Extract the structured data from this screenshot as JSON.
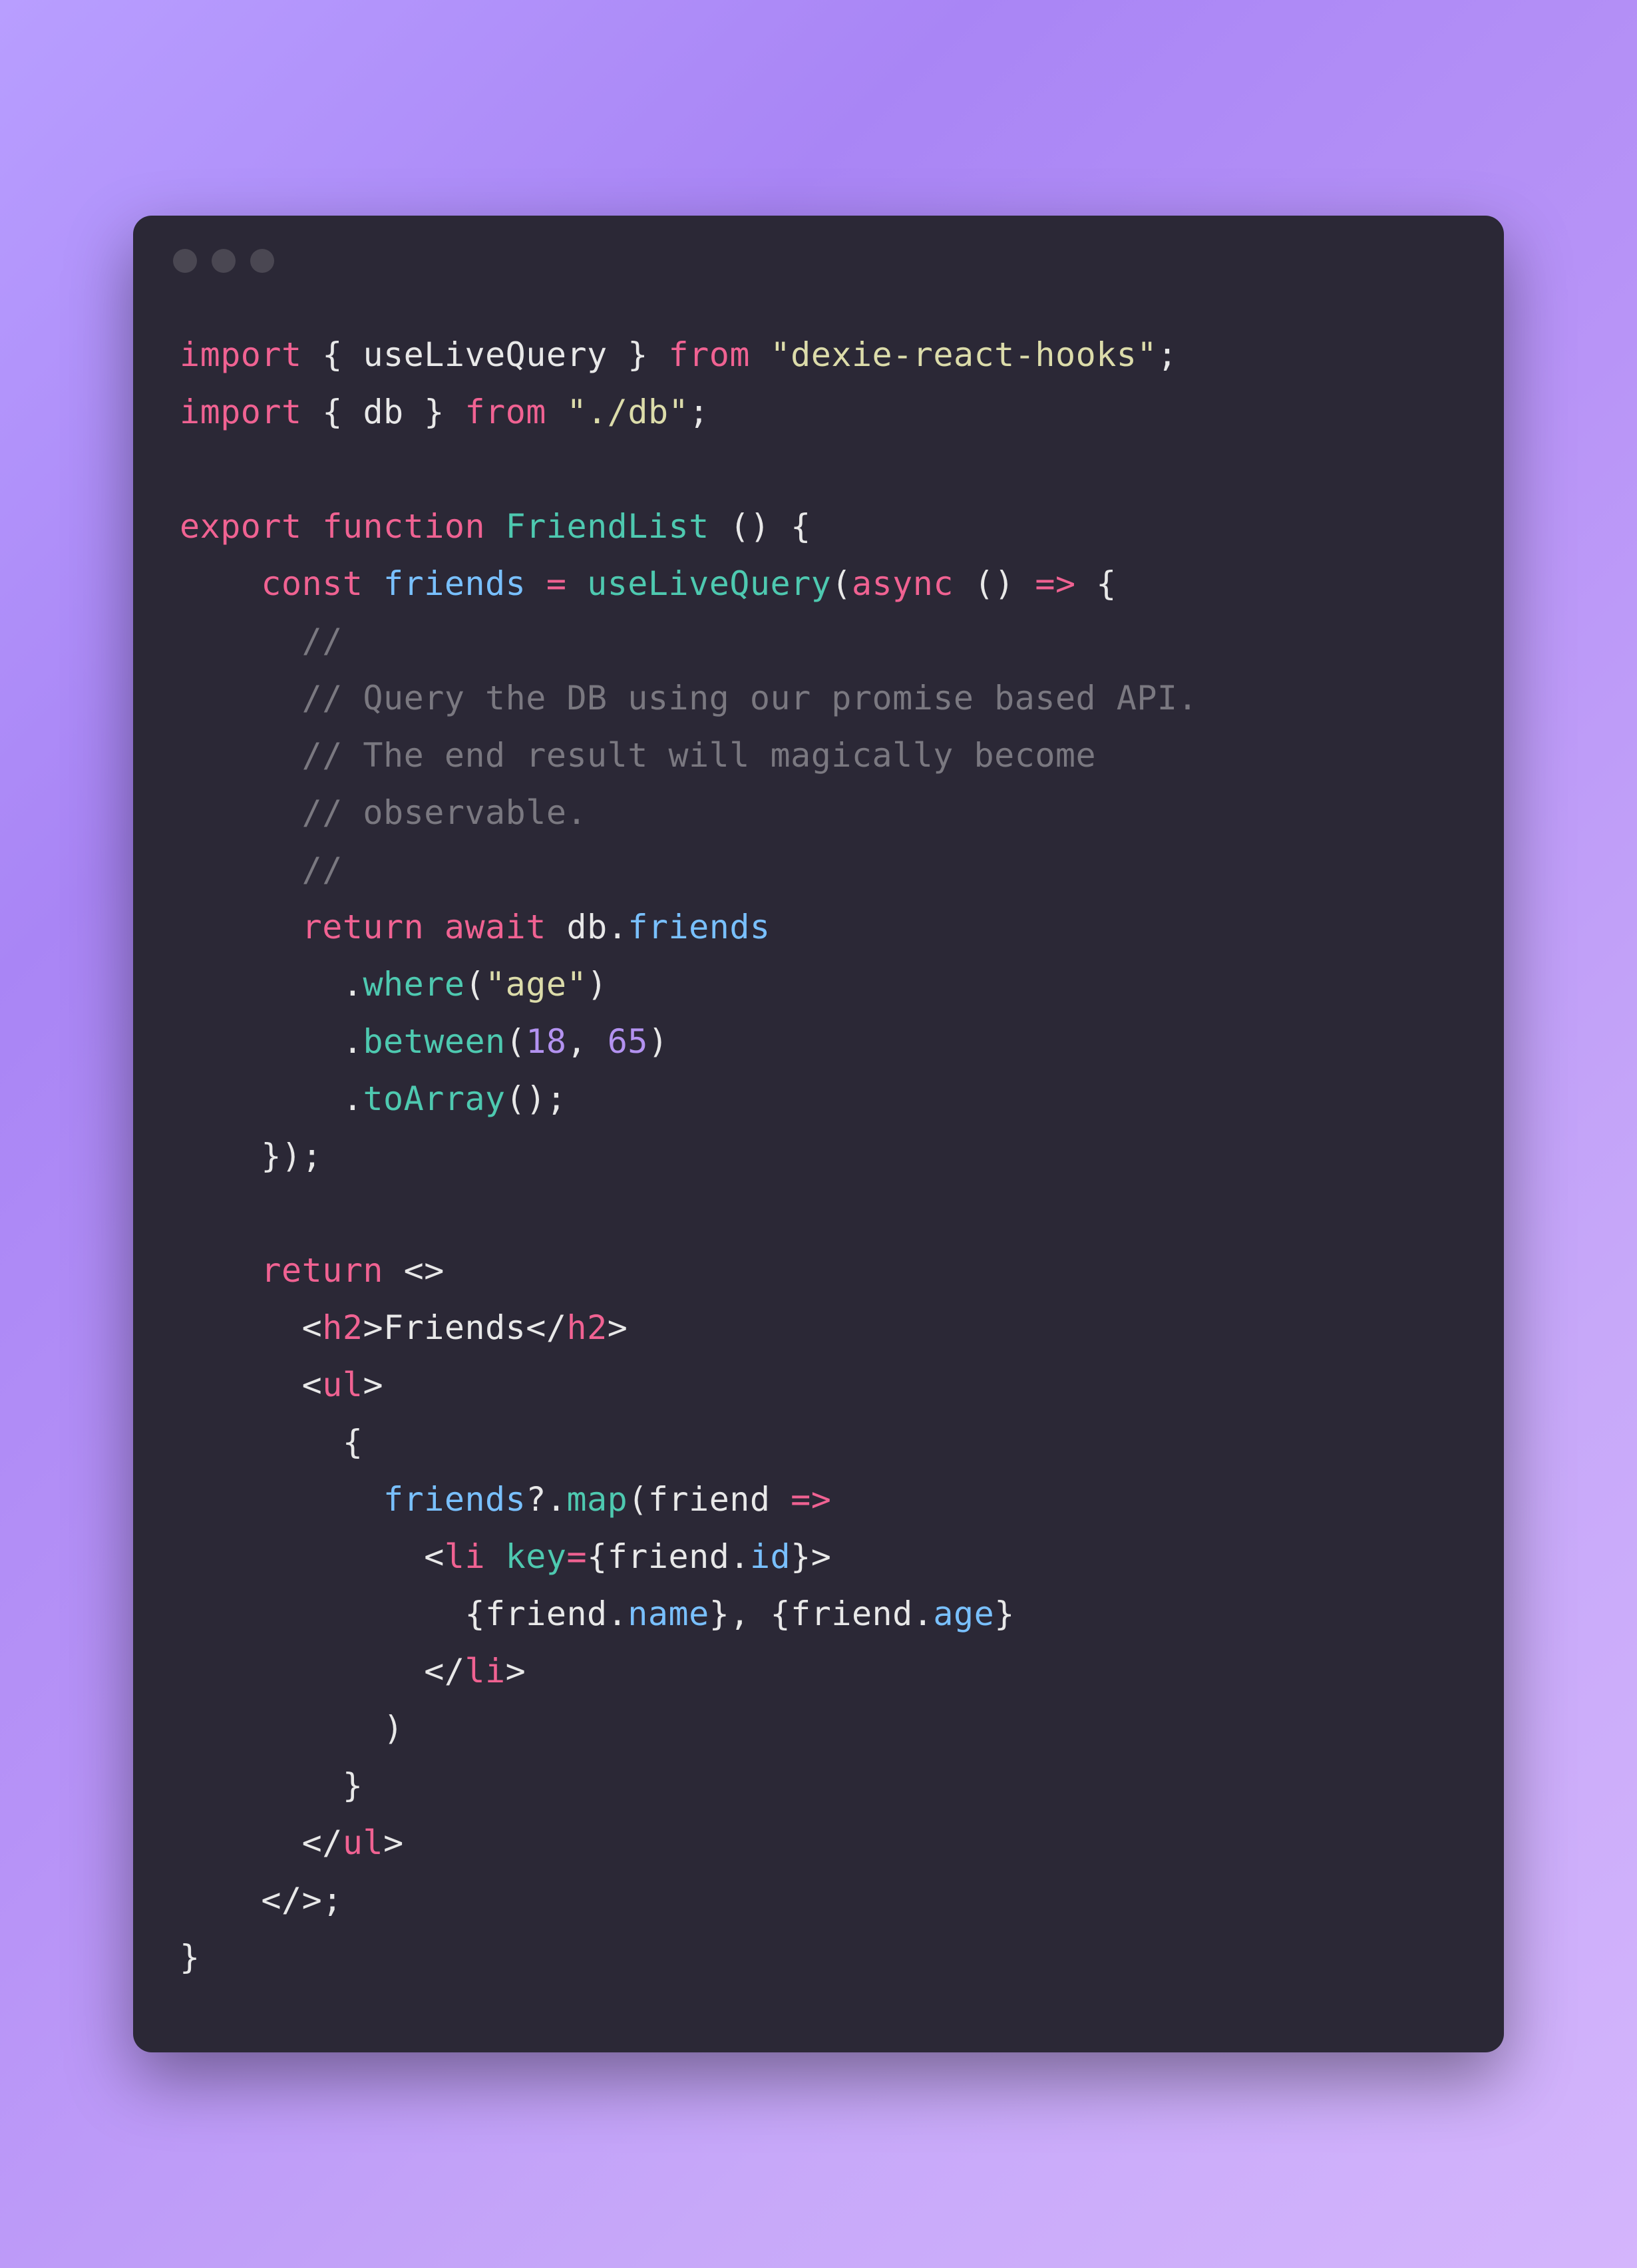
{
  "code": {
    "tokens": [
      {
        "type": "kw-import",
        "text": "import"
      },
      {
        "type": "space",
        "text": " "
      },
      {
        "type": "brace",
        "text": "{"
      },
      {
        "type": "space",
        "text": " "
      },
      {
        "type": "identifier",
        "text": "useLiveQuery"
      },
      {
        "type": "space",
        "text": " "
      },
      {
        "type": "brace",
        "text": "}"
      },
      {
        "type": "space",
        "text": " "
      },
      {
        "type": "kw-from",
        "text": "from"
      },
      {
        "type": "space",
        "text": " "
      },
      {
        "type": "string",
        "text": "\"dexie-react-hooks\""
      },
      {
        "type": "semi",
        "text": ";"
      },
      {
        "type": "newline",
        "text": "\n"
      },
      {
        "type": "kw-import",
        "text": "import"
      },
      {
        "type": "space",
        "text": " "
      },
      {
        "type": "brace",
        "text": "{"
      },
      {
        "type": "space",
        "text": " "
      },
      {
        "type": "identifier",
        "text": "db"
      },
      {
        "type": "space",
        "text": " "
      },
      {
        "type": "brace",
        "text": "}"
      },
      {
        "type": "space",
        "text": " "
      },
      {
        "type": "kw-from",
        "text": "from"
      },
      {
        "type": "space",
        "text": " "
      },
      {
        "type": "string",
        "text": "\"./db\""
      },
      {
        "type": "semi",
        "text": ";"
      },
      {
        "type": "newline",
        "text": "\n"
      },
      {
        "type": "newline",
        "text": "\n"
      },
      {
        "type": "kw-export",
        "text": "export"
      },
      {
        "type": "space",
        "text": " "
      },
      {
        "type": "kw-function",
        "text": "function"
      },
      {
        "type": "space",
        "text": " "
      },
      {
        "type": "func-name",
        "text": "FriendList"
      },
      {
        "type": "space",
        "text": " "
      },
      {
        "type": "paren",
        "text": "()"
      },
      {
        "type": "space",
        "text": " "
      },
      {
        "type": "brace",
        "text": "{"
      },
      {
        "type": "newline",
        "text": "\n"
      },
      {
        "type": "space",
        "text": "    "
      },
      {
        "type": "kw-const",
        "text": "const"
      },
      {
        "type": "space",
        "text": " "
      },
      {
        "type": "var-name",
        "text": "friends"
      },
      {
        "type": "space",
        "text": " "
      },
      {
        "type": "eq",
        "text": "="
      },
      {
        "type": "space",
        "text": " "
      },
      {
        "type": "method",
        "text": "useLiveQuery"
      },
      {
        "type": "paren",
        "text": "("
      },
      {
        "type": "kw-async",
        "text": "async"
      },
      {
        "type": "space",
        "text": " "
      },
      {
        "type": "paren",
        "text": "()"
      },
      {
        "type": "space",
        "text": " "
      },
      {
        "type": "arrow",
        "text": "=>"
      },
      {
        "type": "space",
        "text": " "
      },
      {
        "type": "brace",
        "text": "{"
      },
      {
        "type": "newline",
        "text": "\n"
      },
      {
        "type": "space",
        "text": "      "
      },
      {
        "type": "comment",
        "text": "//"
      },
      {
        "type": "newline",
        "text": "\n"
      },
      {
        "type": "space",
        "text": "      "
      },
      {
        "type": "comment",
        "text": "// Query the DB using our promise based API."
      },
      {
        "type": "newline",
        "text": "\n"
      },
      {
        "type": "space",
        "text": "      "
      },
      {
        "type": "comment",
        "text": "// The end result will magically become"
      },
      {
        "type": "newline",
        "text": "\n"
      },
      {
        "type": "space",
        "text": "      "
      },
      {
        "type": "comment",
        "text": "// observable."
      },
      {
        "type": "newline",
        "text": "\n"
      },
      {
        "type": "space",
        "text": "      "
      },
      {
        "type": "comment",
        "text": "//"
      },
      {
        "type": "newline",
        "text": "\n"
      },
      {
        "type": "space",
        "text": "      "
      },
      {
        "type": "kw-return",
        "text": "return"
      },
      {
        "type": "space",
        "text": " "
      },
      {
        "type": "kw-await",
        "text": "await"
      },
      {
        "type": "space",
        "text": " "
      },
      {
        "type": "identifier",
        "text": "db"
      },
      {
        "type": "dot",
        "text": "."
      },
      {
        "type": "prop",
        "text": "friends"
      },
      {
        "type": "newline",
        "text": "\n"
      },
      {
        "type": "space",
        "text": "        "
      },
      {
        "type": "dot",
        "text": "."
      },
      {
        "type": "method",
        "text": "where"
      },
      {
        "type": "paren",
        "text": "("
      },
      {
        "type": "string",
        "text": "\"age\""
      },
      {
        "type": "paren",
        "text": ")"
      },
      {
        "type": "newline",
        "text": "\n"
      },
      {
        "type": "space",
        "text": "        "
      },
      {
        "type": "dot",
        "text": "."
      },
      {
        "type": "method",
        "text": "between"
      },
      {
        "type": "paren",
        "text": "("
      },
      {
        "type": "number",
        "text": "18"
      },
      {
        "type": "comma",
        "text": ","
      },
      {
        "type": "space",
        "text": " "
      },
      {
        "type": "number",
        "text": "65"
      },
      {
        "type": "paren",
        "text": ")"
      },
      {
        "type": "newline",
        "text": "\n"
      },
      {
        "type": "space",
        "text": "        "
      },
      {
        "type": "dot",
        "text": "."
      },
      {
        "type": "method",
        "text": "toArray"
      },
      {
        "type": "paren",
        "text": "()"
      },
      {
        "type": "semi",
        "text": ";"
      },
      {
        "type": "newline",
        "text": "\n"
      },
      {
        "type": "space",
        "text": "    "
      },
      {
        "type": "brace",
        "text": "}"
      },
      {
        "type": "paren",
        "text": ")"
      },
      {
        "type": "semi",
        "text": ";"
      },
      {
        "type": "newline",
        "text": "\n"
      },
      {
        "type": "newline",
        "text": "\n"
      },
      {
        "type": "space",
        "text": "    "
      },
      {
        "type": "kw-return",
        "text": "return"
      },
      {
        "type": "space",
        "text": " "
      },
      {
        "type": "jsx-angle",
        "text": "<>"
      },
      {
        "type": "newline",
        "text": "\n"
      },
      {
        "type": "space",
        "text": "      "
      },
      {
        "type": "jsx-angle",
        "text": "<"
      },
      {
        "type": "jsx-tag",
        "text": "h2"
      },
      {
        "type": "jsx-angle",
        "text": ">"
      },
      {
        "type": "jsx-text",
        "text": "Friends"
      },
      {
        "type": "jsx-angle",
        "text": "</"
      },
      {
        "type": "jsx-tag",
        "text": "h2"
      },
      {
        "type": "jsx-angle",
        "text": ">"
      },
      {
        "type": "newline",
        "text": "\n"
      },
      {
        "type": "space",
        "text": "      "
      },
      {
        "type": "jsx-angle",
        "text": "<"
      },
      {
        "type": "jsx-tag",
        "text": "ul"
      },
      {
        "type": "jsx-angle",
        "text": ">"
      },
      {
        "type": "newline",
        "text": "\n"
      },
      {
        "type": "space",
        "text": "        "
      },
      {
        "type": "jsx-expr-brace",
        "text": "{"
      },
      {
        "type": "newline",
        "text": "\n"
      },
      {
        "type": "space",
        "text": "          "
      },
      {
        "type": "var-name",
        "text": "friends"
      },
      {
        "type": "qmark",
        "text": "?"
      },
      {
        "type": "dot",
        "text": "."
      },
      {
        "type": "method",
        "text": "map"
      },
      {
        "type": "paren",
        "text": "("
      },
      {
        "type": "param",
        "text": "friend"
      },
      {
        "type": "space",
        "text": " "
      },
      {
        "type": "arrow",
        "text": "=>"
      },
      {
        "type": "newline",
        "text": "\n"
      },
      {
        "type": "space",
        "text": "            "
      },
      {
        "type": "jsx-angle",
        "text": "<"
      },
      {
        "type": "jsx-tag",
        "text": "li"
      },
      {
        "type": "space",
        "text": " "
      },
      {
        "type": "jsx-attr",
        "text": "key"
      },
      {
        "type": "eq",
        "text": "="
      },
      {
        "type": "jsx-expr-brace",
        "text": "{"
      },
      {
        "type": "identifier",
        "text": "friend"
      },
      {
        "type": "dot",
        "text": "."
      },
      {
        "type": "prop",
        "text": "id"
      },
      {
        "type": "jsx-expr-brace",
        "text": "}"
      },
      {
        "type": "jsx-angle",
        "text": ">"
      },
      {
        "type": "newline",
        "text": "\n"
      },
      {
        "type": "space",
        "text": "              "
      },
      {
        "type": "jsx-expr-brace",
        "text": "{"
      },
      {
        "type": "identifier",
        "text": "friend"
      },
      {
        "type": "dot",
        "text": "."
      },
      {
        "type": "prop",
        "text": "name"
      },
      {
        "type": "jsx-expr-brace",
        "text": "}"
      },
      {
        "type": "comma",
        "text": ","
      },
      {
        "type": "space",
        "text": " "
      },
      {
        "type": "jsx-expr-brace",
        "text": "{"
      },
      {
        "type": "identifier",
        "text": "friend"
      },
      {
        "type": "dot",
        "text": "."
      },
      {
        "type": "prop",
        "text": "age"
      },
      {
        "type": "jsx-expr-brace",
        "text": "}"
      },
      {
        "type": "newline",
        "text": "\n"
      },
      {
        "type": "space",
        "text": "            "
      },
      {
        "type": "jsx-angle",
        "text": "</"
      },
      {
        "type": "jsx-tag",
        "text": "li"
      },
      {
        "type": "jsx-angle",
        "text": ">"
      },
      {
        "type": "newline",
        "text": "\n"
      },
      {
        "type": "space",
        "text": "          "
      },
      {
        "type": "paren",
        "text": ")"
      },
      {
        "type": "newline",
        "text": "\n"
      },
      {
        "type": "space",
        "text": "        "
      },
      {
        "type": "jsx-expr-brace",
        "text": "}"
      },
      {
        "type": "newline",
        "text": "\n"
      },
      {
        "type": "space",
        "text": "      "
      },
      {
        "type": "jsx-angle",
        "text": "</"
      },
      {
        "type": "jsx-tag",
        "text": "ul"
      },
      {
        "type": "jsx-angle",
        "text": ">"
      },
      {
        "type": "newline",
        "text": "\n"
      },
      {
        "type": "space",
        "text": "    "
      },
      {
        "type": "jsx-angle",
        "text": "</>"
      },
      {
        "type": "semi",
        "text": ";"
      },
      {
        "type": "newline",
        "text": "\n"
      },
      {
        "type": "brace",
        "text": "}"
      }
    ]
  }
}
